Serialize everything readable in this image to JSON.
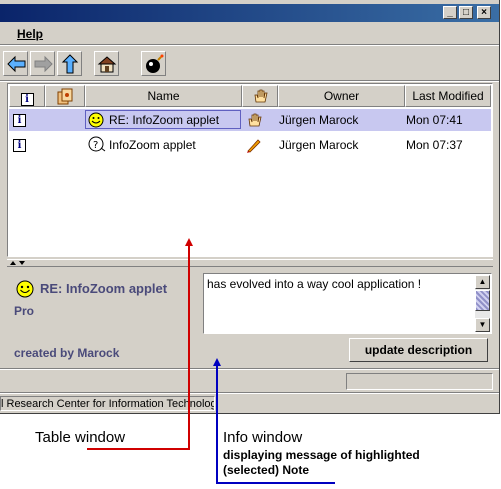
{
  "window": {
    "menu": {
      "help_label": "Help"
    },
    "controls": {
      "minimize": "_",
      "maximize": "□",
      "close": "×"
    }
  },
  "toolbar": {
    "buttons": [
      {
        "icon": "arrow-left-icon",
        "enabled": true
      },
      {
        "icon": "arrow-right-icon",
        "enabled": false
      },
      {
        "icon": "arrow-up-icon",
        "enabled": true
      },
      {
        "icon": "home-icon",
        "enabled": true
      },
      {
        "icon": "bomb-icon",
        "enabled": true
      }
    ]
  },
  "table": {
    "columns": {
      "info_icon": "info-icon",
      "type_icon": "notes-icon",
      "name": "Name",
      "hand_icon": "hand-icon",
      "owner": "Owner",
      "last_modified": "Last Modified"
    },
    "rows": [
      {
        "icon": "smiley-icon",
        "name": "RE: InfoZoom applet",
        "status_icon": "hand-icon",
        "owner": "Jürgen Marock",
        "modified": "Mon 07:41",
        "selected": true
      },
      {
        "icon": "question-face-icon",
        "name": "InfoZoom applet",
        "status_icon": "pen-icon",
        "owner": "Jürgen Marock",
        "modified": "Mon 07:37",
        "selected": false
      }
    ]
  },
  "info": {
    "title": "RE: InfoZoom applet",
    "subtitle": "Pro",
    "created": "created by Marock",
    "message": "has evolved into a way cool application !",
    "update_button": "update description"
  },
  "status": {
    "text": "l Research Center for Information Technology"
  },
  "annotations": {
    "table_window": "Table window",
    "info_window": "Info window",
    "info_desc1": "displaying message of highlighted",
    "info_desc2": "(selected) Note",
    "colors": {
      "table_arrow": "#d00000",
      "info_arrow": "#0000c0"
    }
  }
}
